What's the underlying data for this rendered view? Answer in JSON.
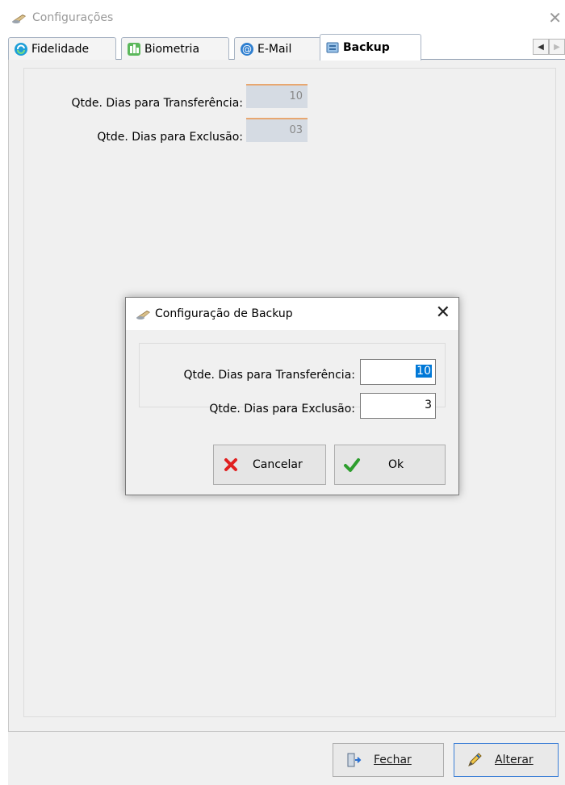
{
  "window": {
    "title": "Configurações",
    "close_icon": "close-icon"
  },
  "tabs": [
    {
      "label": "Fidelidade",
      "icon": "refresh-icon",
      "active": false
    },
    {
      "label": "Biometria",
      "icon": "fingerprint-icon",
      "active": false
    },
    {
      "label": "E-Mail",
      "icon": "email-icon",
      "active": false
    },
    {
      "label": "Backup",
      "icon": "backup-icon",
      "active": true
    }
  ],
  "backup_page": {
    "transfer_label": "Qtde. Dias para Transferência:",
    "transfer_value": "10",
    "delete_label": "Qtde. Dias para Exclusão:",
    "delete_value": "03"
  },
  "footer": {
    "close_label": "Fechar",
    "alter_label": "Alterar"
  },
  "dialog": {
    "title": "Configuração de Backup",
    "transfer_label": "Qtde. Dias para Transferência:",
    "transfer_value": "10",
    "delete_label": "Qtde. Dias para Exclusão:",
    "delete_value": "3",
    "cancel_label": "Cancelar",
    "ok_label": "Ok"
  },
  "colors": {
    "accent": "#0078d7",
    "readonly_field": "#d5dbe3",
    "readonly_border": "#e8a770",
    "cancel_x": "#e02020",
    "ok_check": "#2e9e2e"
  }
}
